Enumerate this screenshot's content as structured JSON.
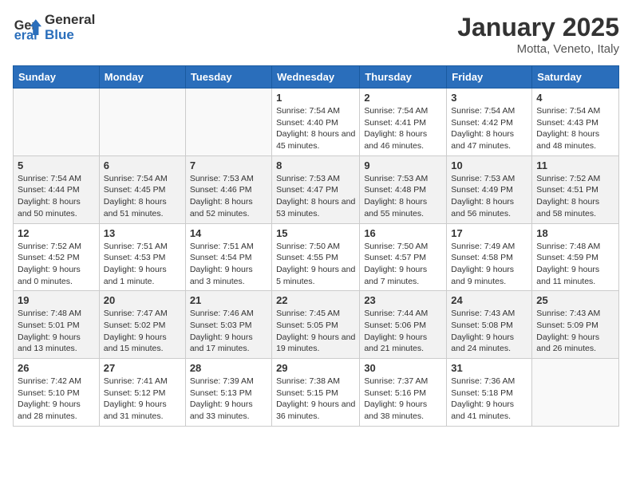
{
  "header": {
    "logo": {
      "general": "General",
      "blue": "Blue"
    },
    "title": "January 2025",
    "location": "Motta, Veneto, Italy"
  },
  "weekdays": [
    "Sunday",
    "Monday",
    "Tuesday",
    "Wednesday",
    "Thursday",
    "Friday",
    "Saturday"
  ],
  "weeks": [
    [
      {
        "day": "",
        "sunrise": "",
        "sunset": "",
        "daylight": ""
      },
      {
        "day": "",
        "sunrise": "",
        "sunset": "",
        "daylight": ""
      },
      {
        "day": "",
        "sunrise": "",
        "sunset": "",
        "daylight": ""
      },
      {
        "day": "1",
        "sunrise": "7:54 AM",
        "sunset": "4:40 PM",
        "daylight": "8 hours and 45 minutes."
      },
      {
        "day": "2",
        "sunrise": "7:54 AM",
        "sunset": "4:41 PM",
        "daylight": "8 hours and 46 minutes."
      },
      {
        "day": "3",
        "sunrise": "7:54 AM",
        "sunset": "4:42 PM",
        "daylight": "8 hours and 47 minutes."
      },
      {
        "day": "4",
        "sunrise": "7:54 AM",
        "sunset": "4:43 PM",
        "daylight": "8 hours and 48 minutes."
      }
    ],
    [
      {
        "day": "5",
        "sunrise": "7:54 AM",
        "sunset": "4:44 PM",
        "daylight": "8 hours and 50 minutes."
      },
      {
        "day": "6",
        "sunrise": "7:54 AM",
        "sunset": "4:45 PM",
        "daylight": "8 hours and 51 minutes."
      },
      {
        "day": "7",
        "sunrise": "7:53 AM",
        "sunset": "4:46 PM",
        "daylight": "8 hours and 52 minutes."
      },
      {
        "day": "8",
        "sunrise": "7:53 AM",
        "sunset": "4:47 PM",
        "daylight": "8 hours and 53 minutes."
      },
      {
        "day": "9",
        "sunrise": "7:53 AM",
        "sunset": "4:48 PM",
        "daylight": "8 hours and 55 minutes."
      },
      {
        "day": "10",
        "sunrise": "7:53 AM",
        "sunset": "4:49 PM",
        "daylight": "8 hours and 56 minutes."
      },
      {
        "day": "11",
        "sunrise": "7:52 AM",
        "sunset": "4:51 PM",
        "daylight": "8 hours and 58 minutes."
      }
    ],
    [
      {
        "day": "12",
        "sunrise": "7:52 AM",
        "sunset": "4:52 PM",
        "daylight": "9 hours and 0 minutes."
      },
      {
        "day": "13",
        "sunrise": "7:51 AM",
        "sunset": "4:53 PM",
        "daylight": "9 hours and 1 minute."
      },
      {
        "day": "14",
        "sunrise": "7:51 AM",
        "sunset": "4:54 PM",
        "daylight": "9 hours and 3 minutes."
      },
      {
        "day": "15",
        "sunrise": "7:50 AM",
        "sunset": "4:55 PM",
        "daylight": "9 hours and 5 minutes."
      },
      {
        "day": "16",
        "sunrise": "7:50 AM",
        "sunset": "4:57 PM",
        "daylight": "9 hours and 7 minutes."
      },
      {
        "day": "17",
        "sunrise": "7:49 AM",
        "sunset": "4:58 PM",
        "daylight": "9 hours and 9 minutes."
      },
      {
        "day": "18",
        "sunrise": "7:48 AM",
        "sunset": "4:59 PM",
        "daylight": "9 hours and 11 minutes."
      }
    ],
    [
      {
        "day": "19",
        "sunrise": "7:48 AM",
        "sunset": "5:01 PM",
        "daylight": "9 hours and 13 minutes."
      },
      {
        "day": "20",
        "sunrise": "7:47 AM",
        "sunset": "5:02 PM",
        "daylight": "9 hours and 15 minutes."
      },
      {
        "day": "21",
        "sunrise": "7:46 AM",
        "sunset": "5:03 PM",
        "daylight": "9 hours and 17 minutes."
      },
      {
        "day": "22",
        "sunrise": "7:45 AM",
        "sunset": "5:05 PM",
        "daylight": "9 hours and 19 minutes."
      },
      {
        "day": "23",
        "sunrise": "7:44 AM",
        "sunset": "5:06 PM",
        "daylight": "9 hours and 21 minutes."
      },
      {
        "day": "24",
        "sunrise": "7:43 AM",
        "sunset": "5:08 PM",
        "daylight": "9 hours and 24 minutes."
      },
      {
        "day": "25",
        "sunrise": "7:43 AM",
        "sunset": "5:09 PM",
        "daylight": "9 hours and 26 minutes."
      }
    ],
    [
      {
        "day": "26",
        "sunrise": "7:42 AM",
        "sunset": "5:10 PM",
        "daylight": "9 hours and 28 minutes."
      },
      {
        "day": "27",
        "sunrise": "7:41 AM",
        "sunset": "5:12 PM",
        "daylight": "9 hours and 31 minutes."
      },
      {
        "day": "28",
        "sunrise": "7:39 AM",
        "sunset": "5:13 PM",
        "daylight": "9 hours and 33 minutes."
      },
      {
        "day": "29",
        "sunrise": "7:38 AM",
        "sunset": "5:15 PM",
        "daylight": "9 hours and 36 minutes."
      },
      {
        "day": "30",
        "sunrise": "7:37 AM",
        "sunset": "5:16 PM",
        "daylight": "9 hours and 38 minutes."
      },
      {
        "day": "31",
        "sunrise": "7:36 AM",
        "sunset": "5:18 PM",
        "daylight": "9 hours and 41 minutes."
      },
      {
        "day": "",
        "sunrise": "",
        "sunset": "",
        "daylight": ""
      }
    ]
  ],
  "labels": {
    "sunrise": "Sunrise:",
    "sunset": "Sunset:",
    "daylight": "Daylight:"
  }
}
